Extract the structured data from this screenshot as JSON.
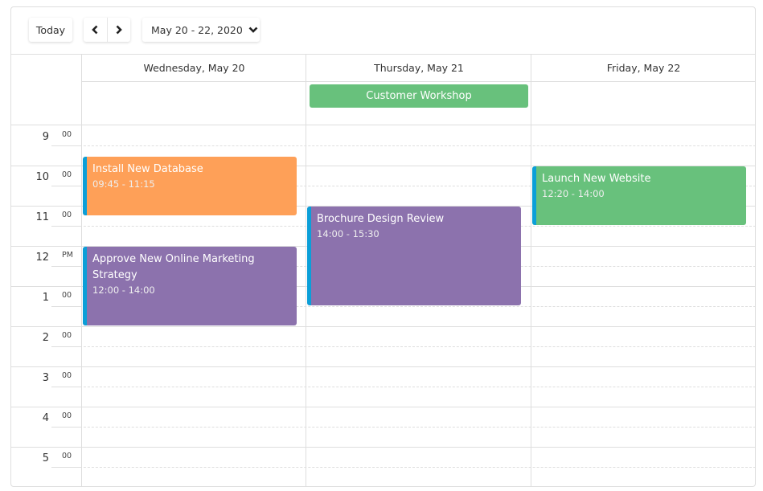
{
  "toolbar": {
    "today_label": "Today",
    "prev_icon": "chevron-left-icon",
    "next_icon": "chevron-right-icon",
    "date_range_label": "May 20 - 22, 2020",
    "date_range_icon": "chevron-down-icon"
  },
  "days": [
    {
      "label": "Wednesday, May 20"
    },
    {
      "label": "Thursday, May 21"
    },
    {
      "label": "Friday, May 22"
    }
  ],
  "time_slots": [
    {
      "hour": "9",
      "suffix": "00"
    },
    {
      "hour": "10",
      "suffix": "00"
    },
    {
      "hour": "11",
      "suffix": "00"
    },
    {
      "hour": "12",
      "suffix": "PM"
    },
    {
      "hour": "1",
      "suffix": "00"
    },
    {
      "hour": "2",
      "suffix": "00"
    },
    {
      "hour": "3",
      "suffix": "00"
    },
    {
      "hour": "4",
      "suffix": "00"
    },
    {
      "hour": "5",
      "suffix": "00"
    }
  ],
  "view_start_hour": 9,
  "view_end_hour": 18,
  "all_day_events": [
    {
      "title": "Customer Workshop",
      "day": 1,
      "color": "#68c17c"
    }
  ],
  "events": [
    {
      "title": "Install New Database",
      "time": "09:45 - 11:15",
      "day": 0,
      "start": "09:45",
      "end": "11:15",
      "color": "#fea058"
    },
    {
      "title": "Approve New Online Marketing Strategy",
      "time": "12:00 - 14:00",
      "day": 0,
      "start": "12:00",
      "end": "14:00",
      "color": "#8c72ad"
    },
    {
      "title": "Brochure Design Review",
      "time": "14:00 - 15:30",
      "day": 1,
      "start": "11:00",
      "end": "13:30",
      "color": "#8c72ad"
    },
    {
      "title": "Launch New Website",
      "time": "12:20 - 14:00",
      "day": 2,
      "start": "10:00",
      "end": "11:30",
      "color": "#68c17c"
    }
  ],
  "colors": {
    "accent_bar": "#0b9fd8",
    "border": "#dedede"
  }
}
